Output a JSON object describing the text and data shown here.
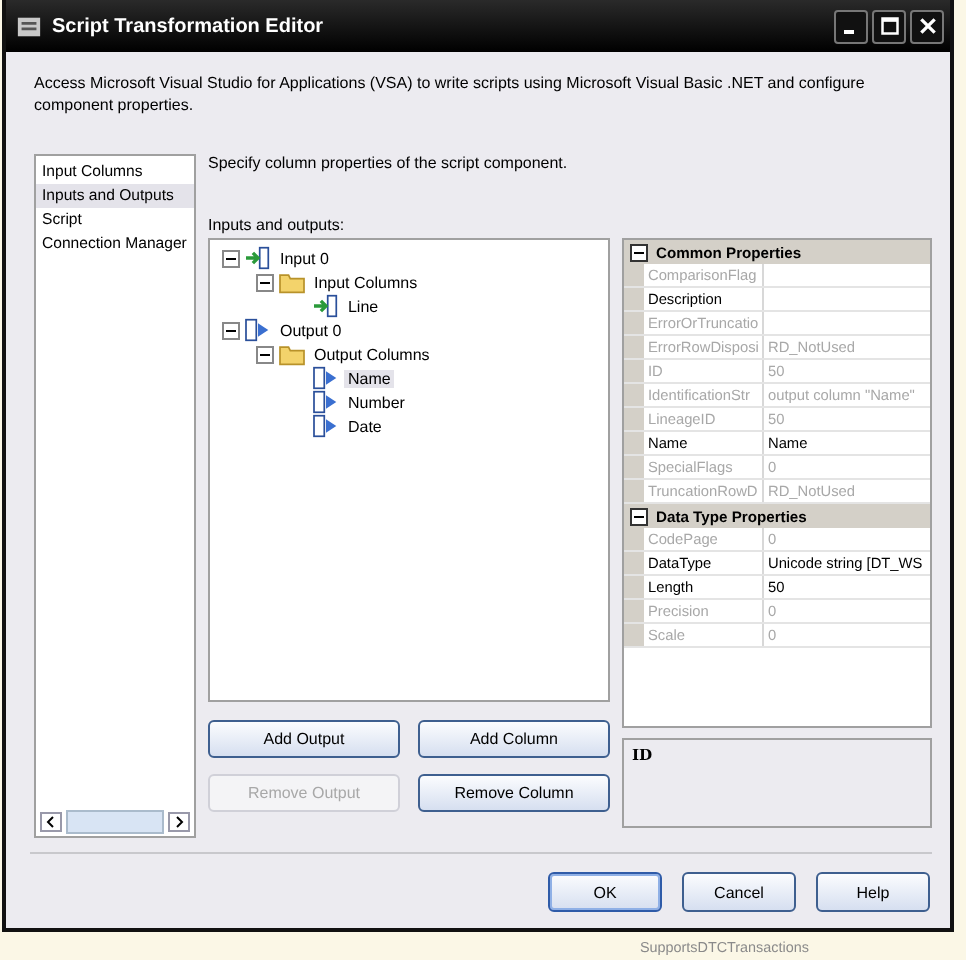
{
  "window": {
    "title": "Script Transformation Editor"
  },
  "description": "Access Microsoft Visual Studio for Applications (VSA) to write scripts using Microsoft Visual Basic .NET and configure component properties.",
  "sidebar": {
    "items": [
      {
        "label": "Input Columns",
        "selected": false
      },
      {
        "label": "Inputs and Outputs",
        "selected": true
      },
      {
        "label": "Script",
        "selected": false
      },
      {
        "label": "Connection Manager",
        "selected": false
      }
    ]
  },
  "page_caption": "Specify column properties of the script component.",
  "tree_label": "Inputs and outputs:",
  "tree": [
    {
      "label": "Input 0",
      "kind": "input",
      "expanded": true,
      "selected": false,
      "children": [
        {
          "label": "Input Columns",
          "kind": "folder",
          "expanded": true,
          "selected": false,
          "children": [
            {
              "label": "Line",
              "kind": "input",
              "selected": false
            }
          ]
        }
      ]
    },
    {
      "label": "Output 0",
      "kind": "output",
      "expanded": true,
      "selected": false,
      "children": [
        {
          "label": "Output Columns",
          "kind": "folder",
          "expanded": true,
          "selected": false,
          "children": [
            {
              "label": "Name",
              "kind": "output",
              "selected": true
            },
            {
              "label": "Number",
              "kind": "output",
              "selected": false
            },
            {
              "label": "Date",
              "kind": "output",
              "selected": false
            }
          ]
        }
      ]
    }
  ],
  "properties": [
    {
      "category": "Common Properties",
      "expanded": true,
      "rows": [
        {
          "name": "ComparisonFlag",
          "value": "",
          "disabled": true
        },
        {
          "name": "Description",
          "value": "",
          "disabled": false
        },
        {
          "name": "ErrorOrTruncatio",
          "value": "",
          "disabled": true
        },
        {
          "name": "ErrorRowDisposi",
          "value": "RD_NotUsed",
          "disabled": true
        },
        {
          "name": "ID",
          "value": "50",
          "disabled": true
        },
        {
          "name": "IdentificationStr",
          "value": "output column \"Name\"",
          "disabled": true
        },
        {
          "name": "LineageID",
          "value": "50",
          "disabled": true
        },
        {
          "name": "Name",
          "value": "Name",
          "disabled": false
        },
        {
          "name": "SpecialFlags",
          "value": "0",
          "disabled": true
        },
        {
          "name": "TruncationRowD",
          "value": "RD_NotUsed",
          "disabled": true
        }
      ]
    },
    {
      "category": "Data Type Properties",
      "expanded": true,
      "rows": [
        {
          "name": "CodePage",
          "value": "0",
          "disabled": true
        },
        {
          "name": "DataType",
          "value": "Unicode string [DT_WS",
          "disabled": false
        },
        {
          "name": "Length",
          "value": "50",
          "disabled": false
        },
        {
          "name": "Precision",
          "value": "0",
          "disabled": true
        },
        {
          "name": "Scale",
          "value": "0",
          "disabled": true
        }
      ]
    }
  ],
  "property_help": {
    "title": "ID"
  },
  "tree_buttons": [
    {
      "label": "Add Output",
      "disabled": false
    },
    {
      "label": "Add Column",
      "disabled": false
    },
    {
      "label": "Remove Output",
      "disabled": true
    },
    {
      "label": "Remove Column",
      "disabled": false
    }
  ],
  "footer_buttons": [
    {
      "label": "OK",
      "default": true
    },
    {
      "label": "Cancel",
      "default": false
    },
    {
      "label": "Help",
      "default": false
    }
  ],
  "background_text": "SupportsDTCTransactions"
}
